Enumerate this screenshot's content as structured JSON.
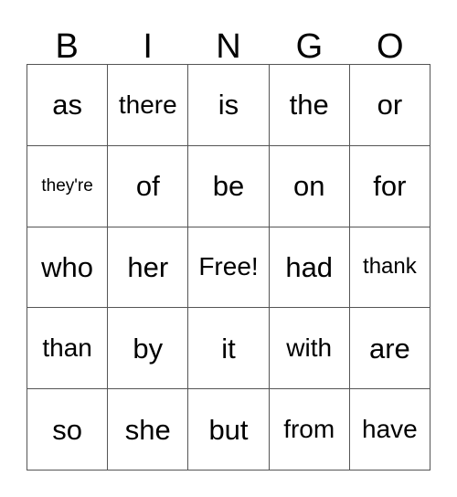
{
  "card": {
    "type": "bingo-card",
    "header": {
      "letters": [
        "B",
        "I",
        "N",
        "G",
        "O"
      ]
    },
    "colors": {
      "background": "#ffffff",
      "grid_line": "#555555",
      "text": "#000000"
    },
    "grid": {
      "columns": 5,
      "rows": 5,
      "free_space": "Free!",
      "free_space_position": {
        "row": 3,
        "column": 3
      },
      "rows_data": [
        [
          {
            "text": "as",
            "size": "md"
          },
          {
            "text": "there",
            "size": "sm"
          },
          {
            "text": "is",
            "size": "md"
          },
          {
            "text": "the",
            "size": "md"
          },
          {
            "text": "or",
            "size": "md"
          }
        ],
        [
          {
            "text": "they're",
            "size": "xxs"
          },
          {
            "text": "of",
            "size": "md"
          },
          {
            "text": "be",
            "size": "md"
          },
          {
            "text": "on",
            "size": "md"
          },
          {
            "text": "for",
            "size": "md"
          }
        ],
        [
          {
            "text": "who",
            "size": "md"
          },
          {
            "text": "her",
            "size": "md"
          },
          {
            "text": "Free!",
            "size": "sm"
          },
          {
            "text": "had",
            "size": "md"
          },
          {
            "text": "thank",
            "size": "xs"
          }
        ],
        [
          {
            "text": "than",
            "size": "sm"
          },
          {
            "text": "by",
            "size": "md"
          },
          {
            "text": "it",
            "size": "md"
          },
          {
            "text": "with",
            "size": "sm"
          },
          {
            "text": "are",
            "size": "md"
          }
        ],
        [
          {
            "text": "so",
            "size": "md"
          },
          {
            "text": "she",
            "size": "md"
          },
          {
            "text": "but",
            "size": "md"
          },
          {
            "text": "from",
            "size": "sm"
          },
          {
            "text": "have",
            "size": "sm"
          }
        ]
      ]
    }
  }
}
